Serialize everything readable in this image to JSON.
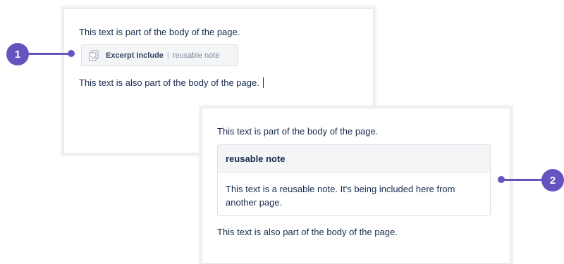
{
  "editor": {
    "line_before": "This text is part of the body of the page.",
    "macro": {
      "name": "Excerpt Include",
      "separator": "|",
      "param": "reusable note"
    },
    "line_after": "This text is also part of the body of the page."
  },
  "rendered": {
    "line_before": "This text is part of the body of the page.",
    "note": {
      "title": "reusable note",
      "body": "This text is a reusable note. It's being included here from another page."
    },
    "line_after": "This text is also part of the body of the page."
  },
  "callouts": [
    {
      "number": "1"
    },
    {
      "number": "2"
    }
  ],
  "colors": {
    "accent": "#6554c0",
    "macro_bg": "#f4f5f7",
    "text": "#172b4d"
  },
  "icons": {
    "macro": "excerpt-include-icon"
  }
}
